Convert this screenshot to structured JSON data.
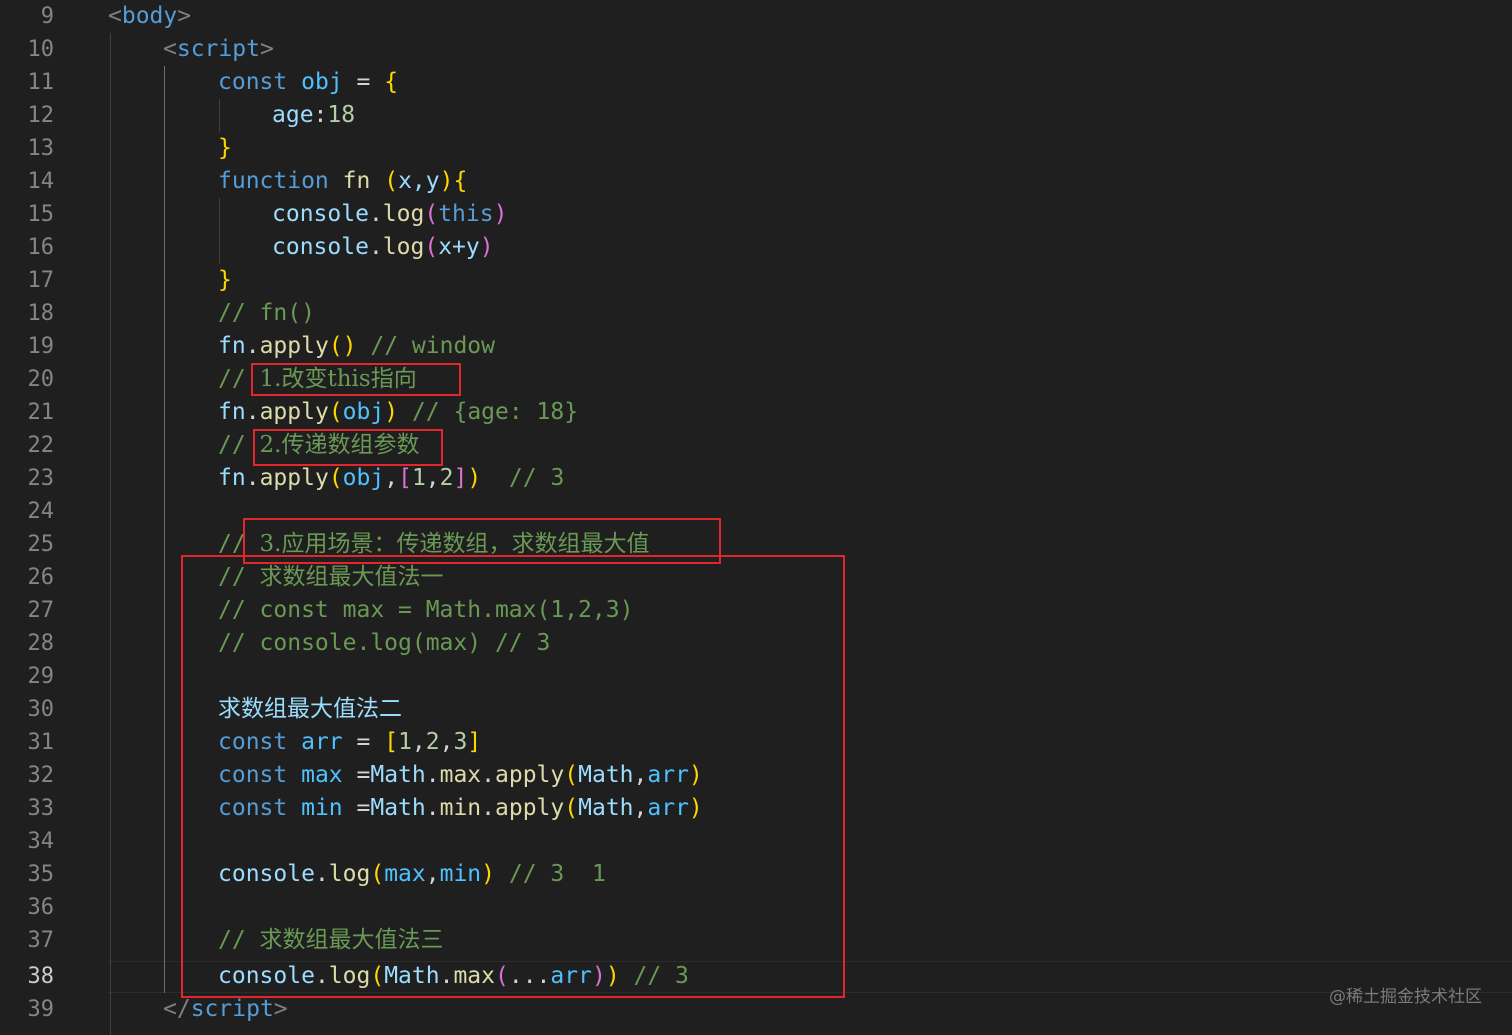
{
  "line_numbers": [
    "9",
    "10",
    "11",
    "12",
    "13",
    "14",
    "15",
    "16",
    "17",
    "18",
    "19",
    "20",
    "21",
    "22",
    "23",
    "24",
    "25",
    "26",
    "27",
    "28",
    "29",
    "30",
    "31",
    "32",
    "33",
    "34",
    "35",
    "36",
    "37",
    "38",
    "39"
  ],
  "active_line_number": "38",
  "code": {
    "l9": {
      "lt": "<",
      "tag": "body",
      "gt": ">"
    },
    "l10": {
      "lt": "<",
      "tag": "script",
      "gt": ">"
    },
    "l11": {
      "kw": "const",
      "name": "obj",
      "eq": " = ",
      "brace": "{"
    },
    "l12": {
      "prop": "age",
      "colon": ":",
      "num": "18"
    },
    "l13": {
      "brace": "}"
    },
    "l14": {
      "kw": "function",
      "name": "fn",
      "open": "(",
      "params": "x,y",
      "close": ")",
      "brace": "{"
    },
    "l15": {
      "obj": "console",
      "dot": ".",
      "method": "log",
      "open": "(",
      "arg": "this",
      "close": ")"
    },
    "l16": {
      "obj": "console",
      "dot": ".",
      "method": "log",
      "open": "(",
      "arg": "x+y",
      "close": ")"
    },
    "l17": {
      "brace": "}"
    },
    "l18": {
      "comment": "// fn()"
    },
    "l19": {
      "obj": "fn",
      "dot": ".",
      "method": "apply",
      "parens": "()",
      "comment": " // window"
    },
    "l20": {
      "slashes": "// ",
      "text": "1.改变this指向"
    },
    "l21": {
      "obj": "fn",
      "dot": ".",
      "method": "apply",
      "open": "(",
      "arg": "obj",
      "close": ")",
      "comment": " // {age: 18}"
    },
    "l22": {
      "slashes": "// ",
      "text": "2.传递数组参数"
    },
    "l23": {
      "obj": "fn",
      "dot": ".",
      "method": "apply",
      "open": "(",
      "arg": "obj",
      "comma": ",",
      "arr_open": "[",
      "n1": "1",
      "c1": ",",
      "n2": "2",
      "arr_close": "]",
      "close": ")",
      "comment": "  // 3"
    },
    "l25": {
      "slashes": "// ",
      "text": "3.应用场景：传递数组，求数组最大值"
    },
    "l26": {
      "slashes": "// ",
      "text": "求数组最大值法一"
    },
    "l27": {
      "comment": "// const max = Math.max(1,2,3)"
    },
    "l28": {
      "comment": "// console.log(max) // 3"
    },
    "l30": {
      "text": "求数组最大值法二"
    },
    "l31": {
      "kw": "const",
      "name": "arr",
      "eq": " = ",
      "arr_open": "[",
      "n1": "1",
      "c1": ",",
      "n2": "2",
      "c2": ",",
      "n3": "3",
      "arr_close": "]"
    },
    "l32": {
      "kw": "const",
      "name": "max",
      "eq": " =",
      "obj": "Math",
      "d1": ".",
      "m1": "max",
      "d2": ".",
      "m2": "apply",
      "open": "(",
      "a1": "Math",
      "comma": ",",
      "a2": "arr",
      "close": ")"
    },
    "l33": {
      "kw": "const",
      "name": "min",
      "eq": " =",
      "obj": "Math",
      "d1": ".",
      "m1": "min",
      "d2": ".",
      "m2": "apply",
      "open": "(",
      "a1": "Math",
      "comma": ",",
      "a2": "arr",
      "close": ")"
    },
    "l35": {
      "obj": "console",
      "dot": ".",
      "method": "log",
      "open": "(",
      "a1": "max",
      "comma": ",",
      "a2": "min",
      "close": ")",
      "comment": " // 3  1"
    },
    "l37": {
      "slashes": "// ",
      "text": "求数组最大值法三"
    },
    "l38": {
      "obj": "console",
      "dot": ".",
      "method": "log",
      "open": "(",
      "obj2": "Math",
      "d2": ".",
      "m2": "max",
      "open2": "(",
      "spread": "...",
      "arg": "arr",
      "close2": ")",
      "close": ")",
      "comment": " // 3"
    },
    "l39": {
      "lt": "</",
      "tag": "script",
      "gt": ">"
    }
  },
  "colors": {
    "background": "#1f1f1f",
    "keyword": "#569cd6",
    "variable": "#4fc1ff",
    "property": "#9cdcfe",
    "function": "#dcdcaa",
    "number": "#b5cea8",
    "comment": "#6a9955",
    "bracket_level1": "#ffd700",
    "bracket_level2": "#da70d6",
    "bracket_level3": "#179fff",
    "annotation_box": "#e2262c"
  },
  "watermark": "@稀土掘金技术社区"
}
